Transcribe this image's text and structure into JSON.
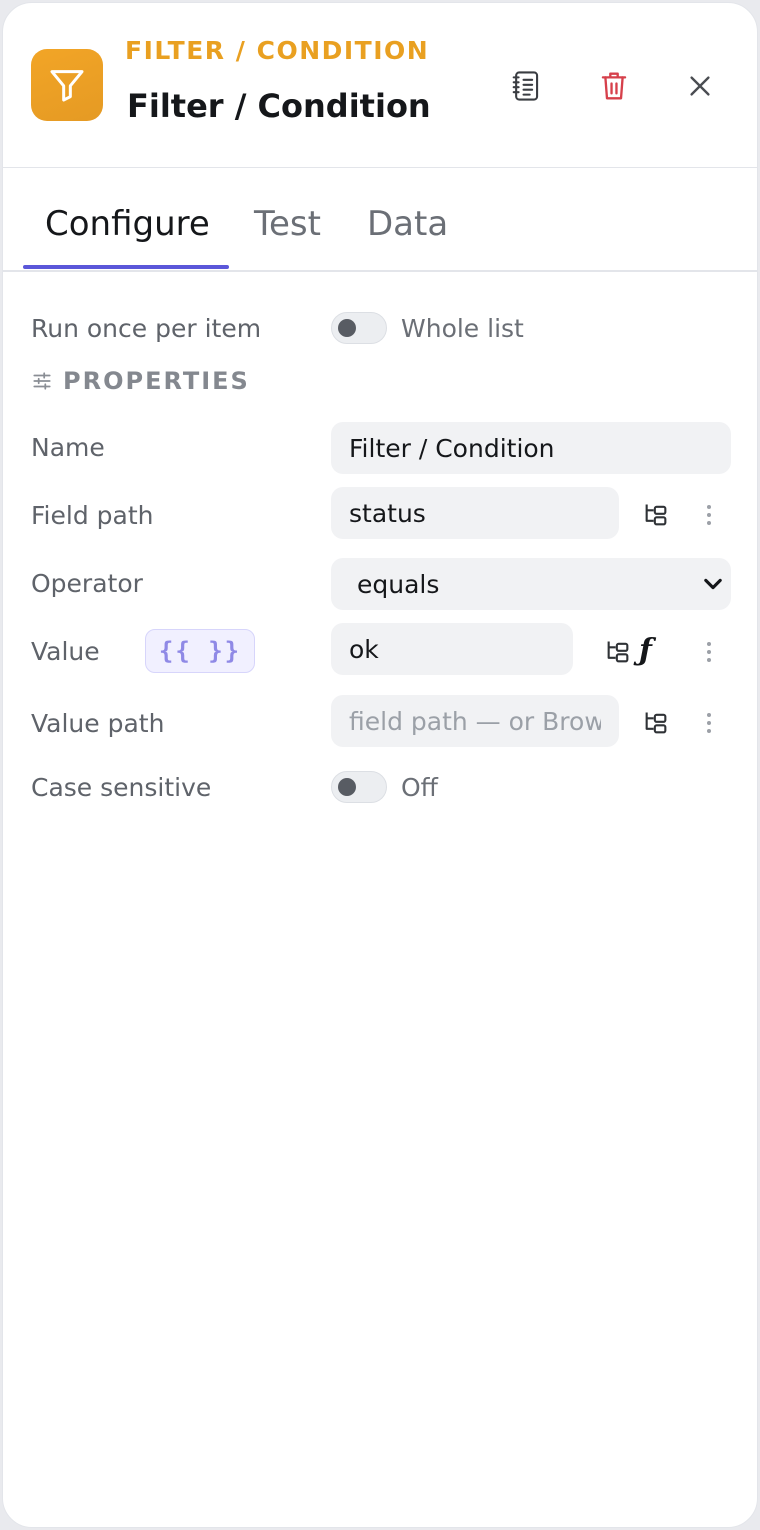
{
  "header": {
    "eyebrow": "FILTER / CONDITION",
    "title": "Filter / Condition",
    "icon": "filter-funnel-icon",
    "accent_color": "#e9a021",
    "actions": [
      "notes-icon",
      "trash-icon",
      "close-icon"
    ]
  },
  "tabs": [
    {
      "label": "Configure",
      "active": true
    },
    {
      "label": "Test",
      "active": false
    },
    {
      "label": "Data",
      "active": false
    }
  ],
  "run_mode": {
    "label": "Run once per item",
    "toggle_text": "Whole list",
    "enabled": false
  },
  "section_title": "PROPERTIES",
  "fields": {
    "name": {
      "label": "Name",
      "value": "Filter / Condition"
    },
    "field_path": {
      "label": "Field path",
      "value": "status"
    },
    "operator": {
      "label": "Operator",
      "value": "equals"
    },
    "value": {
      "label": "Value",
      "expr_chip": "{{ }}",
      "value": "ok",
      "fx": "ƒ"
    },
    "value_path": {
      "label": "Value path",
      "value": "",
      "placeholder": "field path — or Brow"
    },
    "case_sensitive": {
      "label": "Case sensitive",
      "toggle_text": "Off",
      "enabled": false
    }
  },
  "colors": {
    "tab_underline": "#5b57d9",
    "delete": "#d6404b"
  }
}
